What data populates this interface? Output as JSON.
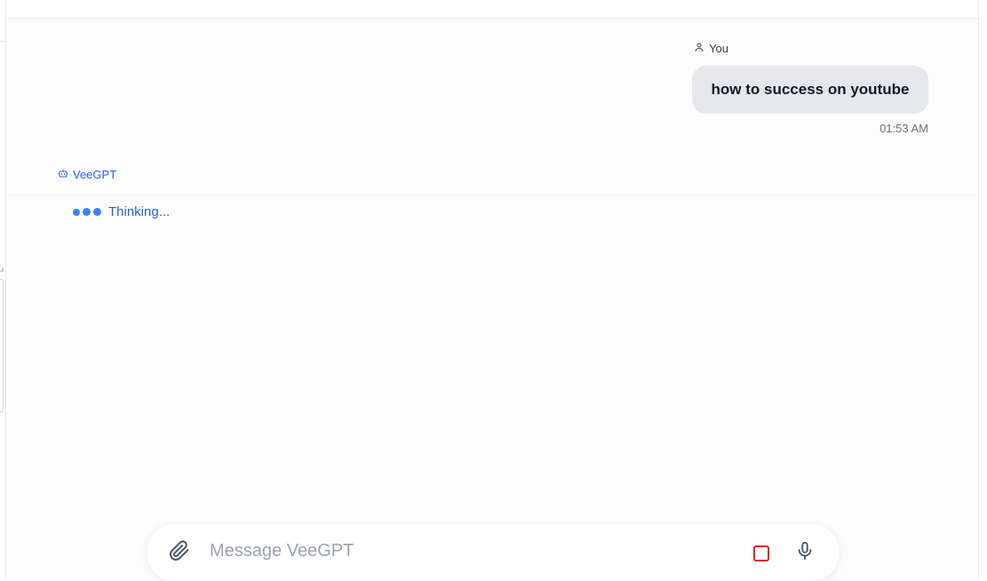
{
  "conversation": {
    "user_message": {
      "author": "You",
      "text": "how to success on youtube",
      "time": "01:53 AM"
    },
    "assistant": {
      "name": "VeeGPT",
      "status_text": "Thinking..."
    }
  },
  "composer": {
    "placeholder": "Message VeeGPT",
    "value": ""
  },
  "icons": {
    "user": "user-icon",
    "bot": "bot-icon",
    "attach": "paperclip-icon",
    "stop": "stop-square-icon",
    "mic": "microphone-icon"
  },
  "colors": {
    "accent": "#2563eb",
    "dots": "#3b82f6",
    "stop": "#dc2626",
    "bubble": "#e5e7eb"
  }
}
